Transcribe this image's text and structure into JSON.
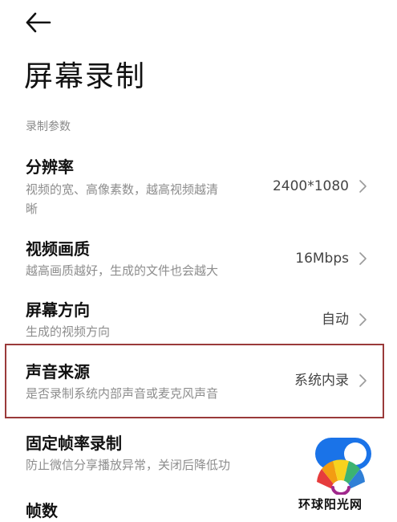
{
  "header": {
    "back_icon": "back-arrow-icon",
    "title": "屏幕录制"
  },
  "section": {
    "label": "录制参数"
  },
  "settings": [
    {
      "title": "分辨率",
      "subtitle_line1": "视频的宽、高像素数，越高视频越清",
      "subtitle_line2": "晰",
      "value": "2400*1080"
    },
    {
      "title": "视频画质",
      "subtitle": "越高画质越好，生成的文件也会越大",
      "value": "16Mbps"
    },
    {
      "title": "屏幕方向",
      "subtitle": "生成的视频方向",
      "value": "自动"
    },
    {
      "title": "声音来源",
      "subtitle": "是否录制系统内部声音或麦克风声音",
      "value": "系统内录"
    },
    {
      "title": "固定帧率录制",
      "subtitle": "防止微信分享播放异常，关闭后降低功",
      "toggle_on": true
    },
    {
      "title": "帧数"
    }
  ],
  "colors": {
    "highlight_border": "#9a3a3a",
    "toggle_on": "#1a73e8"
  },
  "watermark": {
    "text": "环球阳光网"
  }
}
